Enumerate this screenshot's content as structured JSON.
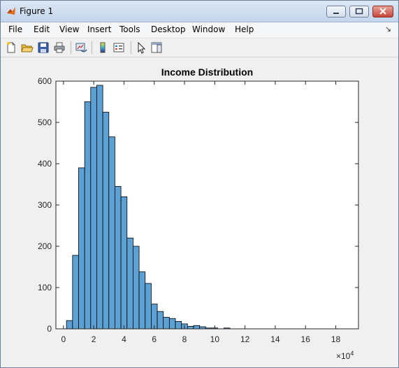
{
  "window": {
    "title": "Figure 1"
  },
  "menu": {
    "items": [
      "File",
      "Edit",
      "View",
      "Insert",
      "Tools",
      "Desktop",
      "Window",
      "Help"
    ]
  },
  "toolbar": {
    "icons": [
      "new-figure-icon",
      "open-icon",
      "save-icon",
      "print-icon",
      "link-plot-icon",
      "colorbar-icon",
      "legend-icon",
      "pointer-icon",
      "property-editor-icon"
    ]
  },
  "chart_data": {
    "type": "bar",
    "title": "Income Distribution",
    "xlabel": "",
    "ylabel": "",
    "x_multiplier_label": "×10",
    "x_multiplier_exponent": "4",
    "xlim": [
      -0.5,
      19.5
    ],
    "ylim": [
      0,
      600
    ],
    "x_ticks": [
      0,
      2,
      4,
      6,
      8,
      10,
      12,
      14,
      16,
      18
    ],
    "y_ticks": [
      0,
      100,
      200,
      300,
      400,
      500,
      600
    ],
    "bin_width": 0.4,
    "bin_starts": [
      0.2,
      0.6,
      1.0,
      1.4,
      1.8,
      2.2,
      2.6,
      3.0,
      3.4,
      3.8,
      4.2,
      4.6,
      5.0,
      5.4,
      5.8,
      6.2,
      6.6,
      7.0,
      7.4,
      7.8,
      8.2,
      8.6,
      9.0,
      9.4,
      9.8,
      10.2,
      10.6
    ],
    "values": [
      20,
      178,
      390,
      550,
      585,
      590,
      525,
      465,
      345,
      320,
      220,
      200,
      138,
      110,
      60,
      42,
      28,
      25,
      18,
      12,
      6,
      8,
      5,
      2,
      2,
      0,
      2
    ],
    "bar_color": "#5da1d4",
    "edge_color": "#000000",
    "grid": false
  }
}
